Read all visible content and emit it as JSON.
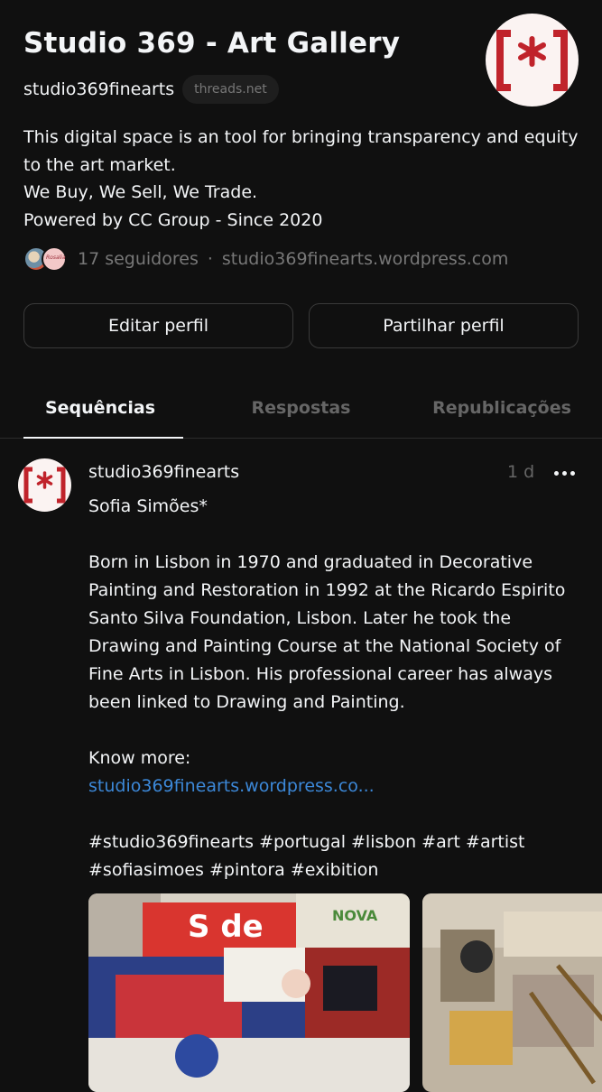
{
  "profile": {
    "name": "Studio 369 - Art Gallery",
    "handle": "studio369finearts",
    "domain_chip": "threads.net",
    "bio": [
      "This digital space is an tool for bringing transparency and equity",
      "to the art market.",
      "We Buy, We Sell, We Trade.",
      "Powered by CC Group - Since 2020"
    ],
    "followers": "17 seguidores",
    "separator": "·",
    "website": "studio369finearts.wordpress.com",
    "follower_avatar_text": "Rosalia",
    "logo_text": "[*]"
  },
  "buttons": {
    "edit": "Editar perfil",
    "share": "Partilhar perfil"
  },
  "tabs": [
    "Sequências",
    "Respostas",
    "Republicações"
  ],
  "post": {
    "author": "studio369finearts",
    "time": "1 d",
    "lines": [
      "Sofia Simões*",
      "",
      "Born in Lisbon in 1970 and graduated in Decorative",
      "Painting and Restoration in 1992 at the Ricardo Espirito",
      "Santo Silva Foundation, Lisbon. Later he took the",
      "Drawing and Painting Course at the National Society of",
      "Fine Arts in Lisbon. His professional career has always",
      "been linked to Drawing and Painting.",
      "",
      "Know more:"
    ],
    "link": "studio369finearts.wordpress.co...",
    "hashtags": [
      "#studio369finearts #portugal #lisbon #art #artist",
      "#sofiasimoes #pintora #exibition"
    ],
    "media_text": [
      "S de",
      "NOVA"
    ]
  },
  "colors": {
    "background": "#101010",
    "text": "#f3f5f7",
    "muted": "#777777",
    "link": "#3c88d8",
    "logo_red": "#c0232b"
  }
}
